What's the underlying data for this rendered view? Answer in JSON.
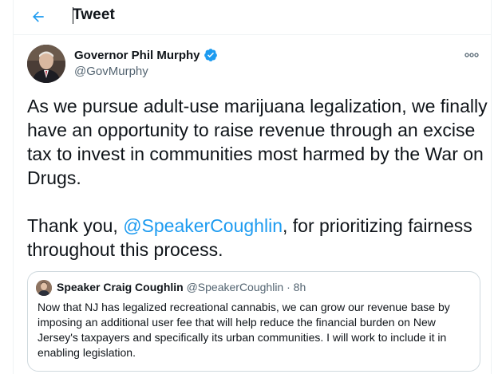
{
  "header": {
    "title": "Tweet",
    "back_icon": "arrow-left-icon"
  },
  "author": {
    "display_name": "Governor Phil Murphy",
    "handle": "@GovMurphy",
    "verified": true
  },
  "tweet": {
    "paragraph1": "As we pursue adult-use marijuana legalization, we finally have an opportunity to raise revenue through an excise tax to invest in communities most harmed by the War on Drugs.",
    "paragraph2_prefix": "Thank you, ",
    "paragraph2_mention": "@SpeakerCoughlin",
    "paragraph2_suffix": ", for prioritizing fairness throughout this process."
  },
  "quote": {
    "display_name": "Speaker Craig Coughlin",
    "handle": "@SpeakerCoughlin",
    "separator": "·",
    "time": "8h",
    "text": "Now that NJ has legalized recreational cannabis, we can grow our revenue base by imposing an additional user fee that will help reduce the financial burden on New Jersey's taxpayers and specifically its urban communities. I will work to include it in enabling legislation."
  },
  "colors": {
    "accent": "#1d9bf0",
    "text": "#0f1419",
    "secondary": "#536471",
    "border": "#cfd9de"
  }
}
